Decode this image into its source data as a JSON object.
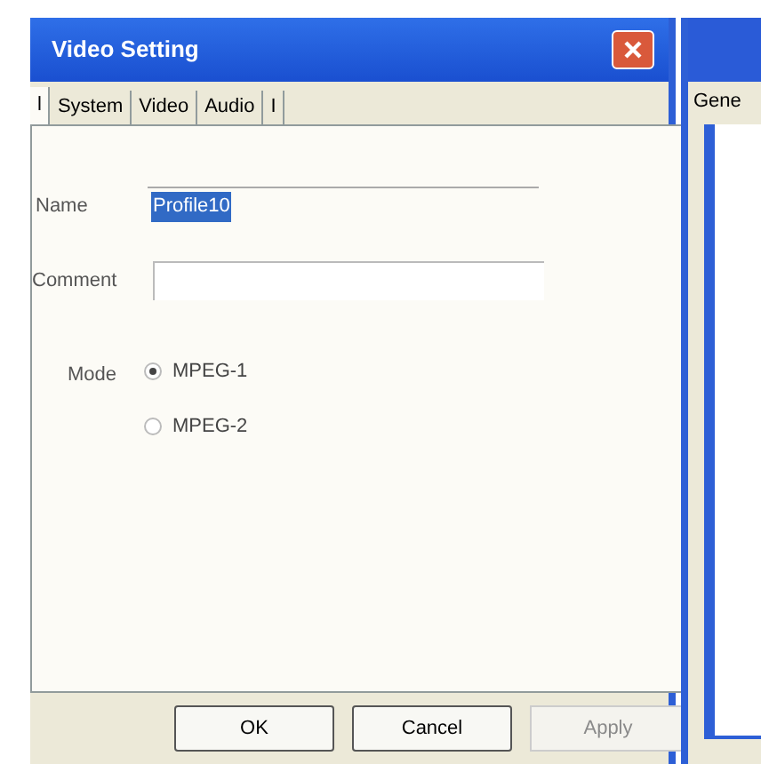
{
  "window": {
    "title": "Video Setting"
  },
  "tabs": [
    {
      "label": "l",
      "selected": true
    },
    {
      "label": "System",
      "selected": false
    },
    {
      "label": "Video",
      "selected": false
    },
    {
      "label": "Audio",
      "selected": false
    },
    {
      "label": "I",
      "selected": false
    }
  ],
  "form": {
    "name_label": "Name",
    "name_value": "Profile10",
    "comment_label": "Comment",
    "mode_label": "Mode"
  },
  "modes": [
    {
      "label": "MPEG-1",
      "selected": true
    },
    {
      "label": "MPEG-2",
      "selected": false
    }
  ],
  "buttons": [
    {
      "label": "OK",
      "disabled": false
    },
    {
      "label": "Cancel",
      "disabled": false
    },
    {
      "label": "Apply",
      "disabled": true
    }
  ],
  "background_window": {
    "tab": "Gene"
  }
}
